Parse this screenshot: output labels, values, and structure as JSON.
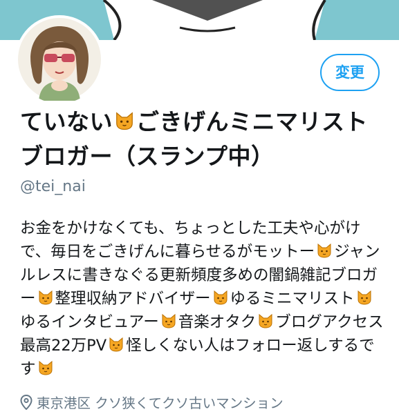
{
  "colors": {
    "accent": "#1da1f2",
    "banner": "#7ec6cf",
    "secondary_text": "#657786"
  },
  "header": {
    "banner_image": "illustration-banner",
    "avatar_image": "cartoon-woman-with-glasses"
  },
  "profile": {
    "edit_button_label": "変更",
    "name_part1": "ていない",
    "name_part2": "ごきげんミニマリストブロガー（スランプ中）",
    "handle": "@tei_nai",
    "bio": {
      "p1": "お金をかけなくても、ちょっとした工夫や心がけで、毎日をごきげんに暮らせるがモットー",
      "p2": "ジャンルレスに書きなぐる更新頻度多めの闇鍋雑記ブロガー",
      "p3": "整理収納アドバイザー",
      "p4": "ゆるミニマリスト",
      "p5": "ゆるインタビュアー",
      "p6": "音楽オタク",
      "p7": "ブログアクセス最高22万PV",
      "p8": "怪しくない人はフォロー返しするです"
    },
    "location": "東京港区 クソ狭くてクソ古いマンション"
  }
}
